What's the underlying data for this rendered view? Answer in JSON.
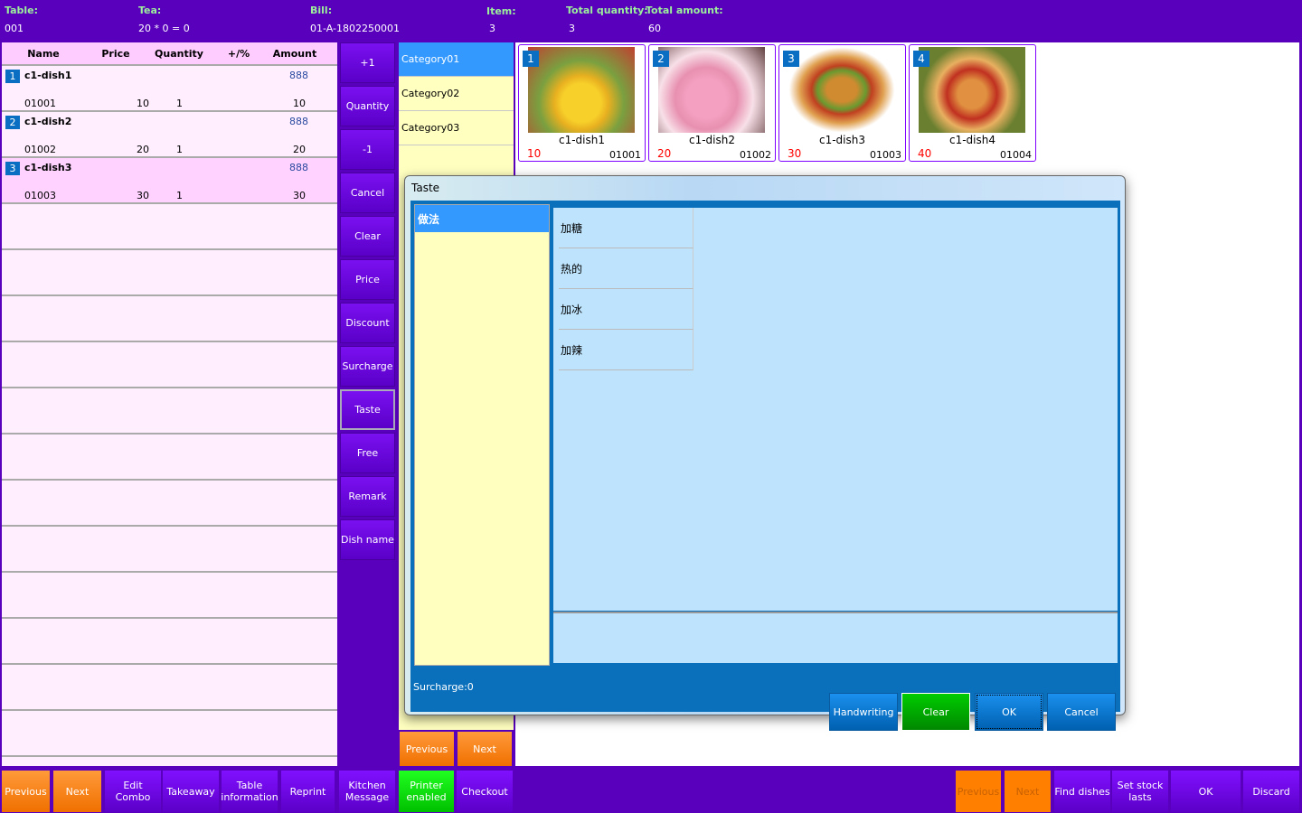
{
  "header": {
    "table_label": "Table:",
    "table_value": "001",
    "tea_label": "Tea:",
    "tea_value": "20 * 0 = 0",
    "bill_label": "Bill:",
    "bill_value": "01-A-1802250001",
    "item_label": "Item:",
    "item_value": "3",
    "total_qty_label": "Total quantity:",
    "total_qty_value": "3",
    "total_amount_label": "Total amount:",
    "total_amount_value": "60"
  },
  "order": {
    "columns": [
      "Name",
      "Price",
      "Quantity",
      "+/%",
      "Amount"
    ],
    "rows": [
      {
        "num": "1",
        "name": "c1-dish1",
        "extra": "888",
        "code": "01001",
        "price": "10",
        "qty": "1",
        "amount": "10"
      },
      {
        "num": "2",
        "name": "c1-dish2",
        "extra": "888",
        "code": "01002",
        "price": "20",
        "qty": "1",
        "amount": "20"
      },
      {
        "num": "3",
        "name": "c1-dish3",
        "extra": "888",
        "code": "01003",
        "price": "30",
        "qty": "1",
        "amount": "30"
      }
    ]
  },
  "functions": [
    "+1",
    "Quantity",
    "-1",
    "Cancel",
    "Clear",
    "Price",
    "Discount",
    "Surcharge",
    "Taste",
    "Free",
    "Remark",
    "Dish name"
  ],
  "categories": [
    "Category01",
    "Category02",
    "Category03"
  ],
  "category_nav": {
    "previous": "Previous",
    "next": "Next"
  },
  "dishes": [
    {
      "num": "1",
      "name": "c1-dish1",
      "price": "10",
      "code": "01001"
    },
    {
      "num": "2",
      "name": "c1-dish2",
      "price": "20",
      "code": "01002"
    },
    {
      "num": "3",
      "name": "c1-dish3",
      "price": "30",
      "code": "01003"
    },
    {
      "num": "4",
      "name": "c1-dish4",
      "price": "40",
      "code": "01004"
    }
  ],
  "dialog": {
    "title": "Taste",
    "groups": [
      "做法"
    ],
    "tastes": [
      "加糖",
      "热的",
      "加冰",
      "加辣"
    ],
    "surcharge": "Surcharge:0",
    "buttons": {
      "handwriting": "Handwriting",
      "clear": "Clear",
      "ok": "OK",
      "cancel": "Cancel"
    }
  },
  "bottom": {
    "left": [
      "Previous",
      "Next",
      "Edit Combo",
      "Takeaway",
      "Table information",
      "Reprint",
      "Kitchen Message",
      "Printer enabled",
      "Checkout"
    ],
    "right": [
      "Previous",
      "Next",
      "Find dishes",
      "Set stock lasts",
      "OK",
      "Discard"
    ]
  },
  "colors": {
    "background": "#5800bc",
    "accent_blue": "#3399ff",
    "orange": "#f07000",
    "green": "#00c000"
  }
}
